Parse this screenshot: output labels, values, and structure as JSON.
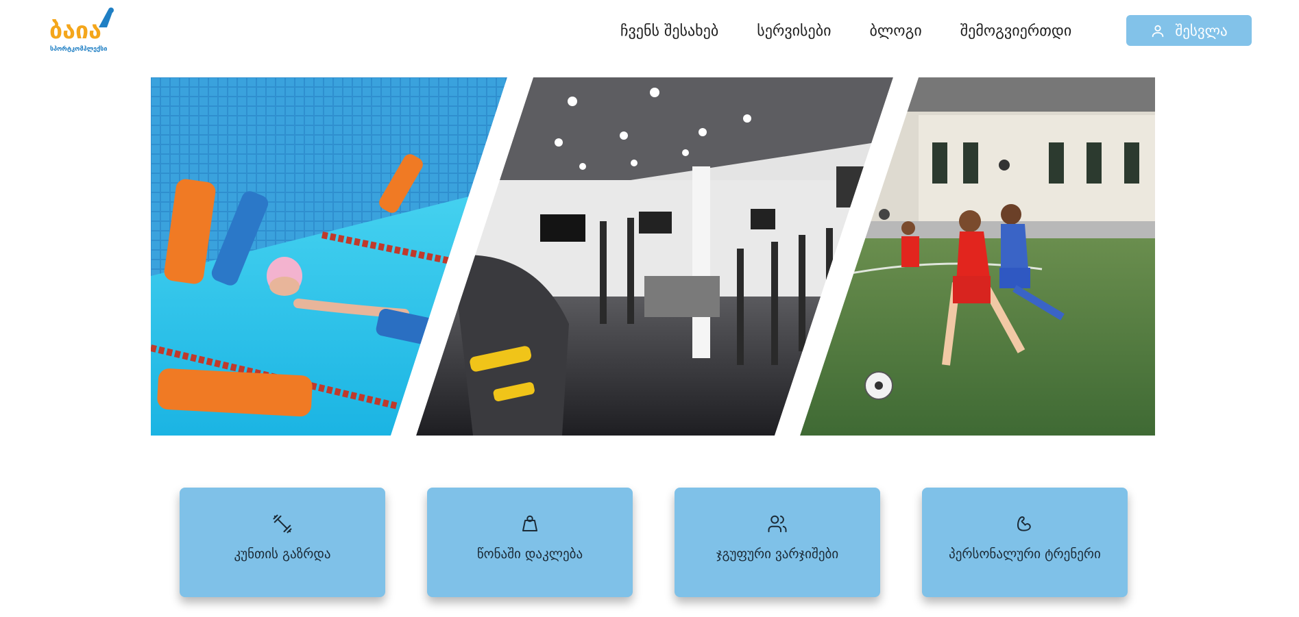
{
  "brand": {
    "name": "ბაია",
    "tagline": "სპორტკომპლექსი",
    "colors": {
      "primary": "#f4a61b",
      "secondary": "#1f7fc4"
    }
  },
  "nav": {
    "items": [
      {
        "label": "ჩვენს შესახებ",
        "name": "nav-about"
      },
      {
        "label": "სერვისები",
        "name": "nav-services"
      },
      {
        "label": "ბლოგი",
        "name": "nav-blog"
      },
      {
        "label": "შემოგვიერთდი",
        "name": "nav-join"
      }
    ]
  },
  "login": {
    "label": "შესვლა",
    "icon": "user-icon"
  },
  "hero": {
    "panels": [
      {
        "name": "hero-pool-panel",
        "scene": "pool"
      },
      {
        "name": "hero-gym-panel",
        "scene": "gym"
      },
      {
        "name": "hero-football-panel",
        "scene": "football"
      }
    ]
  },
  "services": {
    "cards": [
      {
        "label": "კუნთის გაზრდა",
        "icon": "dumbbell-icon"
      },
      {
        "label": "წონაში დაკლება",
        "icon": "weight-icon"
      },
      {
        "label": "ჯგუფური ვარჯიშები",
        "icon": "users-icon"
      },
      {
        "label": "პერსონალური ტრენერი",
        "icon": "bicep-icon"
      }
    ]
  },
  "colors": {
    "accent": "#82c2e9",
    "card": "#7fc1e8"
  }
}
